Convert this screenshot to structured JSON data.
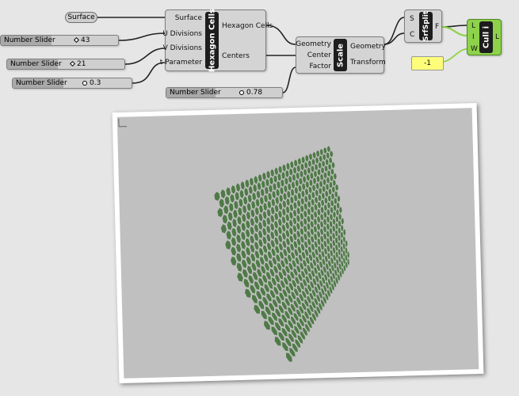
{
  "params": {
    "surface": "Surface"
  },
  "sliders": [
    {
      "label": "Number Slider",
      "value": "43"
    },
    {
      "label": "Number Slider",
      "value": "21"
    },
    {
      "label": "Number Slider",
      "value": "0.3"
    },
    {
      "label": "Number Slider",
      "value": "0.78"
    }
  ],
  "hexagon_cells": {
    "title": "Hexagon Cells",
    "inputs": [
      "Surface",
      "U Divisions",
      "V Divisions",
      "t Parameter"
    ],
    "outputs": [
      "Hexagon Cells",
      "Centers"
    ]
  },
  "scale": {
    "title": "Scale",
    "inputs": [
      "Geometry",
      "Center",
      "Factor"
    ],
    "outputs": [
      "Geometry",
      "Transform"
    ]
  },
  "srfsplit": {
    "title": "SrfSplit",
    "inputs": [
      "S",
      "C"
    ],
    "outputs": [
      "F"
    ]
  },
  "cull": {
    "title": "Cull i",
    "inputs": [
      "L",
      "I",
      "W"
    ],
    "outputs": [
      "L"
    ]
  },
  "panel": {
    "value": "-1"
  },
  "colors": {
    "canvas": "#e6e6e6",
    "component": "#d4d4d4",
    "cull_active": "#8ed24b",
    "panel": "#fdfd7a",
    "mesh": "#4f7a47",
    "viewport": "#c0c0c0"
  },
  "icons": [
    "axis-gizmo-icon"
  ]
}
